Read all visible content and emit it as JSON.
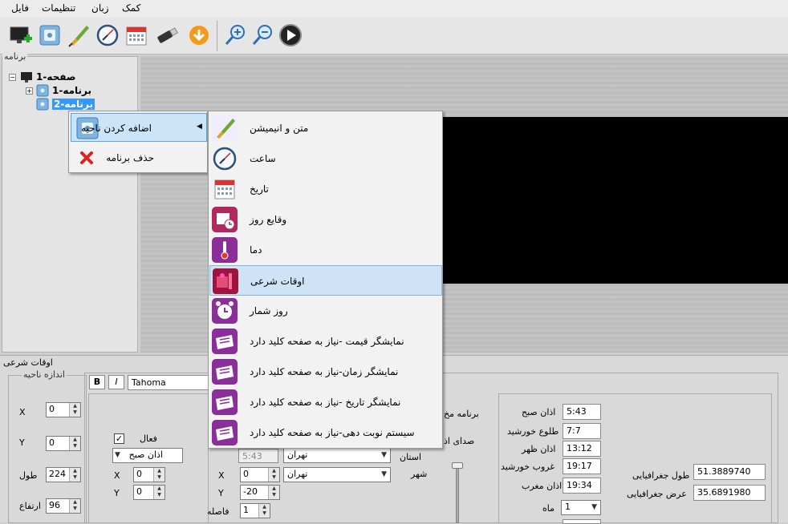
{
  "menubar": {
    "items": [
      {
        "name": "menu-file",
        "label": "فایل"
      },
      {
        "name": "menu-settings",
        "label": "تنظیمات"
      },
      {
        "name": "menu-language",
        "label": "زبان"
      },
      {
        "name": "menu-help",
        "label": "کمک"
      }
    ]
  },
  "left_panel": {
    "title": "برنامه",
    "tree": {
      "page": "صفحه-1",
      "programs": [
        "برنامه-1",
        "برنامه-2"
      ]
    }
  },
  "context_menu": {
    "add_region": "اضافه کردن ناحیه",
    "delete_program": "حذف برنامه"
  },
  "submenu": {
    "items": [
      {
        "label": "متن و انیمیشن",
        "icon": "brush-icon"
      },
      {
        "label": "ساعت",
        "icon": "clock-icon"
      },
      {
        "label": "تاریخ",
        "icon": "calendar-icon"
      },
      {
        "label": "وقایع روز",
        "icon": "events-calendar-icon"
      },
      {
        "label": "دما",
        "icon": "thermometer-icon"
      },
      {
        "label": "اوقات شرعی",
        "icon": "prayer-times-icon"
      },
      {
        "label": "روز شمار",
        "icon": "alarm-clock-icon"
      },
      {
        "label": "نمایشگر  قیمت -نیاز به صفحه کلید دارد",
        "icon": "keyboard-icon"
      },
      {
        "label": "نمایشگر زمان-نیاز به صفحه کلید دارد",
        "icon": "keyboard-icon"
      },
      {
        "label": "نمایشگر تاریخ -نیاز به صفحه کلید دارد",
        "icon": "keyboard-icon"
      },
      {
        "label": "سیستم نوبت دهی-نیاز به صفحه کلید دارد",
        "icon": "keyboard-icon"
      }
    ]
  },
  "bottom": {
    "title": "اوقات شرعی",
    "size_group": {
      "title": "اندازه ناحیه",
      "x_label": "X",
      "x_value": "0",
      "y_label": "Y",
      "y_value": "0",
      "width_label": "طول",
      "width_value": "224",
      "height_label": "ارتفاع",
      "height_value": "96"
    },
    "font_toolbar": {
      "bold": "B",
      "italic": "I",
      "font": "Tahoma"
    },
    "active_label": "فعال",
    "prayer_select": "اذان صبح",
    "x1_label": "X",
    "x1_value": "0",
    "y1_label": "Y",
    "y1_value": "0",
    "time_value": "5:43",
    "x2_label": "X",
    "x2_value": "0",
    "y2_label": "Y",
    "y2_value": "-20",
    "spacing_label": "فاصله",
    "spacing_value": "1",
    "province_select": "تهران",
    "city_select": "تهران",
    "province_label": "استان",
    "city_label": "شهر",
    "program_label": "برنامه مخ",
    "sound_label": "صدای اذ",
    "times": [
      {
        "label": "اذان صبح",
        "value": "5:43"
      },
      {
        "label": "طلوع خورشید",
        "value": "7:7"
      },
      {
        "label": "اذان ظهر",
        "value": "13:12"
      },
      {
        "label": "غروب خورشید",
        "value": "19:17"
      },
      {
        "label": "اذان مغرب",
        "value": "19:34"
      },
      {
        "label": "ماه",
        "value": "1"
      }
    ],
    "longitude_label": "طول جغرافیایی",
    "longitude_value": "51.3889740",
    "latitude_label": "عرض جغرافیایی",
    "latitude_value": "35.6891980"
  },
  "colors": {
    "accent": "#3399ff",
    "highlight": "#cbe4f8",
    "screen": "#000000"
  }
}
